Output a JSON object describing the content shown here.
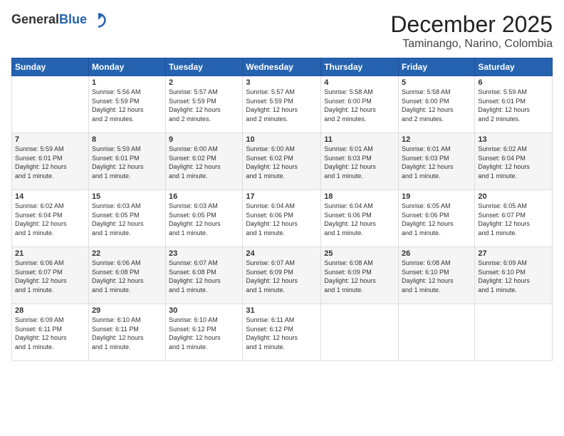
{
  "header": {
    "logo_general": "General",
    "logo_blue": "Blue",
    "month": "December 2025",
    "location": "Taminango, Narino, Colombia"
  },
  "weekdays": [
    "Sunday",
    "Monday",
    "Tuesday",
    "Wednesday",
    "Thursday",
    "Friday",
    "Saturday"
  ],
  "weeks": [
    [
      {
        "day": "",
        "info": ""
      },
      {
        "day": "1",
        "info": "Sunrise: 5:56 AM\nSunset: 5:59 PM\nDaylight: 12 hours\nand 2 minutes."
      },
      {
        "day": "2",
        "info": "Sunrise: 5:57 AM\nSunset: 5:59 PM\nDaylight: 12 hours\nand 2 minutes."
      },
      {
        "day": "3",
        "info": "Sunrise: 5:57 AM\nSunset: 5:59 PM\nDaylight: 12 hours\nand 2 minutes."
      },
      {
        "day": "4",
        "info": "Sunrise: 5:58 AM\nSunset: 6:00 PM\nDaylight: 12 hours\nand 2 minutes."
      },
      {
        "day": "5",
        "info": "Sunrise: 5:58 AM\nSunset: 6:00 PM\nDaylight: 12 hours\nand 2 minutes."
      },
      {
        "day": "6",
        "info": "Sunrise: 5:59 AM\nSunset: 6:01 PM\nDaylight: 12 hours\nand 2 minutes."
      }
    ],
    [
      {
        "day": "7",
        "info": "Sunrise: 5:59 AM\nSunset: 6:01 PM\nDaylight: 12 hours\nand 1 minute."
      },
      {
        "day": "8",
        "info": "Sunrise: 5:59 AM\nSunset: 6:01 PM\nDaylight: 12 hours\nand 1 minute."
      },
      {
        "day": "9",
        "info": "Sunrise: 6:00 AM\nSunset: 6:02 PM\nDaylight: 12 hours\nand 1 minute."
      },
      {
        "day": "10",
        "info": "Sunrise: 6:00 AM\nSunset: 6:02 PM\nDaylight: 12 hours\nand 1 minute."
      },
      {
        "day": "11",
        "info": "Sunrise: 6:01 AM\nSunset: 6:03 PM\nDaylight: 12 hours\nand 1 minute."
      },
      {
        "day": "12",
        "info": "Sunrise: 6:01 AM\nSunset: 6:03 PM\nDaylight: 12 hours\nand 1 minute."
      },
      {
        "day": "13",
        "info": "Sunrise: 6:02 AM\nSunset: 6:04 PM\nDaylight: 12 hours\nand 1 minute."
      }
    ],
    [
      {
        "day": "14",
        "info": "Sunrise: 6:02 AM\nSunset: 6:04 PM\nDaylight: 12 hours\nand 1 minute."
      },
      {
        "day": "15",
        "info": "Sunrise: 6:03 AM\nSunset: 6:05 PM\nDaylight: 12 hours\nand 1 minute."
      },
      {
        "day": "16",
        "info": "Sunrise: 6:03 AM\nSunset: 6:05 PM\nDaylight: 12 hours\nand 1 minute."
      },
      {
        "day": "17",
        "info": "Sunrise: 6:04 AM\nSunset: 6:06 PM\nDaylight: 12 hours\nand 1 minute."
      },
      {
        "day": "18",
        "info": "Sunrise: 6:04 AM\nSunset: 6:06 PM\nDaylight: 12 hours\nand 1 minute."
      },
      {
        "day": "19",
        "info": "Sunrise: 6:05 AM\nSunset: 6:06 PM\nDaylight: 12 hours\nand 1 minute."
      },
      {
        "day": "20",
        "info": "Sunrise: 6:05 AM\nSunset: 6:07 PM\nDaylight: 12 hours\nand 1 minute."
      }
    ],
    [
      {
        "day": "21",
        "info": "Sunrise: 6:06 AM\nSunset: 6:07 PM\nDaylight: 12 hours\nand 1 minute."
      },
      {
        "day": "22",
        "info": "Sunrise: 6:06 AM\nSunset: 6:08 PM\nDaylight: 12 hours\nand 1 minute."
      },
      {
        "day": "23",
        "info": "Sunrise: 6:07 AM\nSunset: 6:08 PM\nDaylight: 12 hours\nand 1 minute."
      },
      {
        "day": "24",
        "info": "Sunrise: 6:07 AM\nSunset: 6:09 PM\nDaylight: 12 hours\nand 1 minute."
      },
      {
        "day": "25",
        "info": "Sunrise: 6:08 AM\nSunset: 6:09 PM\nDaylight: 12 hours\nand 1 minute."
      },
      {
        "day": "26",
        "info": "Sunrise: 6:08 AM\nSunset: 6:10 PM\nDaylight: 12 hours\nand 1 minute."
      },
      {
        "day": "27",
        "info": "Sunrise: 6:09 AM\nSunset: 6:10 PM\nDaylight: 12 hours\nand 1 minute."
      }
    ],
    [
      {
        "day": "28",
        "info": "Sunrise: 6:09 AM\nSunset: 6:11 PM\nDaylight: 12 hours\nand 1 minute."
      },
      {
        "day": "29",
        "info": "Sunrise: 6:10 AM\nSunset: 6:11 PM\nDaylight: 12 hours\nand 1 minute."
      },
      {
        "day": "30",
        "info": "Sunrise: 6:10 AM\nSunset: 6:12 PM\nDaylight: 12 hours\nand 1 minute."
      },
      {
        "day": "31",
        "info": "Sunrise: 6:11 AM\nSunset: 6:12 PM\nDaylight: 12 hours\nand 1 minute."
      },
      {
        "day": "",
        "info": ""
      },
      {
        "day": "",
        "info": ""
      },
      {
        "day": "",
        "info": ""
      }
    ]
  ]
}
